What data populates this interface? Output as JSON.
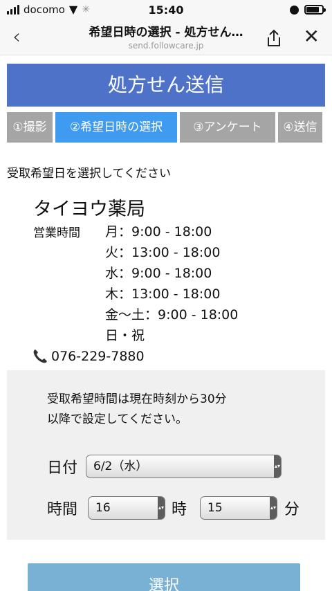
{
  "status_bar": {
    "carrier": "docomo",
    "time": "15:40"
  },
  "browser": {
    "title": "希望日時の選択 - 処方せん…",
    "url": "send.followcare.jp"
  },
  "header": {
    "title": "処方せん送信"
  },
  "steps": [
    {
      "label": "①撮影",
      "active": false
    },
    {
      "label": "②希望日時の選択",
      "active": true
    },
    {
      "label": "③アンケート",
      "active": false
    },
    {
      "label": "④送信",
      "active": false
    }
  ],
  "instruction": "受取希望日を選択してください",
  "pharmacy": {
    "name": "タイヨウ薬局",
    "hours_label": "営業時間",
    "hours": [
      "月：9:00 - 18:00",
      "火：13:00 - 18:00",
      "水：9:00 - 18:00",
      "木：13:00 - 18:00",
      "金～土：9:00 - 18:00",
      "日・祝"
    ],
    "phone": "076-229-7880"
  },
  "time_form": {
    "notice_line1": "受取希望時間は現在時刻から30分",
    "notice_line2": "以降で設定してください。",
    "date_label": "日付",
    "date_value": "6/2（水）",
    "time_label": "時間",
    "hour_value": "16",
    "hour_unit": "時",
    "minute_value": "15",
    "minute_unit": "分"
  },
  "submit": {
    "label": "選択"
  },
  "colors": {
    "header": "#4f72c9",
    "step_active": "#3f9bf0",
    "step_inactive": "#a5a5a5",
    "submit": "#78b1d3"
  }
}
